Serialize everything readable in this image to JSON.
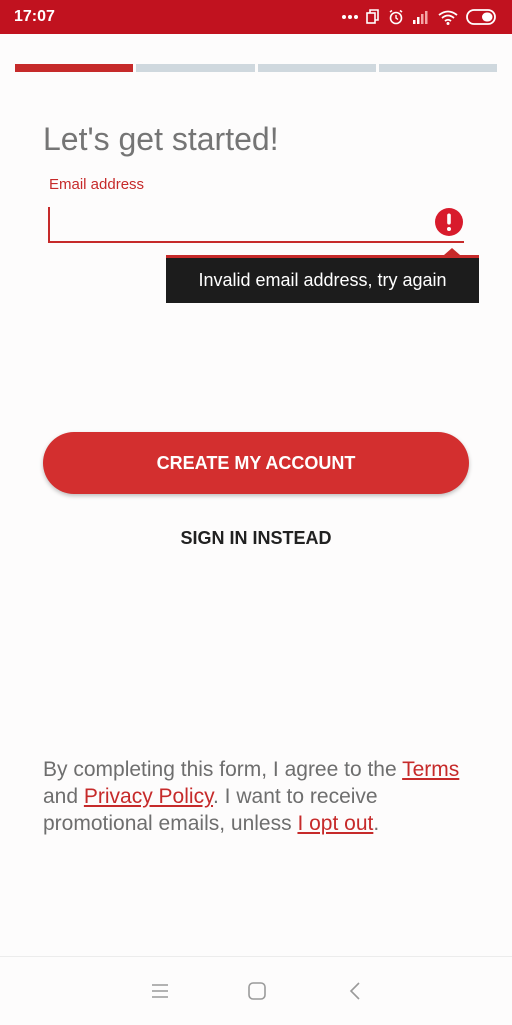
{
  "status_bar": {
    "time": "17:07",
    "background": "#c1121f",
    "icons": [
      "more-dots-icon",
      "tabs-icon",
      "alarm-icon",
      "signal-icon",
      "wifi-icon",
      "battery-icon"
    ]
  },
  "progress": {
    "total_steps": 4,
    "current_step": 1,
    "active_color": "#c62a2a",
    "inactive_color": "#cfd8de"
  },
  "form": {
    "title": "Let's get started!",
    "email": {
      "label": "Email address",
      "value": "",
      "error_icon": "exclamation-circle-icon",
      "error_message": "Invalid email address, try again"
    }
  },
  "actions": {
    "create_label": "CREATE MY ACCOUNT",
    "signin_label": "SIGN IN INSTEAD"
  },
  "legal": {
    "prefix": "By completing this form, I agree to the ",
    "terms_link": "Terms",
    "and": " and ",
    "privacy_link": "Privacy Policy",
    "middle": ". I want to receive promotional emails, unless ",
    "optout_link": "I opt out",
    "suffix": "."
  },
  "nav_bar": {
    "icons": [
      "menu-icon",
      "home-square-icon",
      "back-chevron-icon"
    ]
  },
  "colors": {
    "accent": "#c62a2a",
    "button": "#d32f2f",
    "tooltip_bg": "#1c1c1c"
  }
}
